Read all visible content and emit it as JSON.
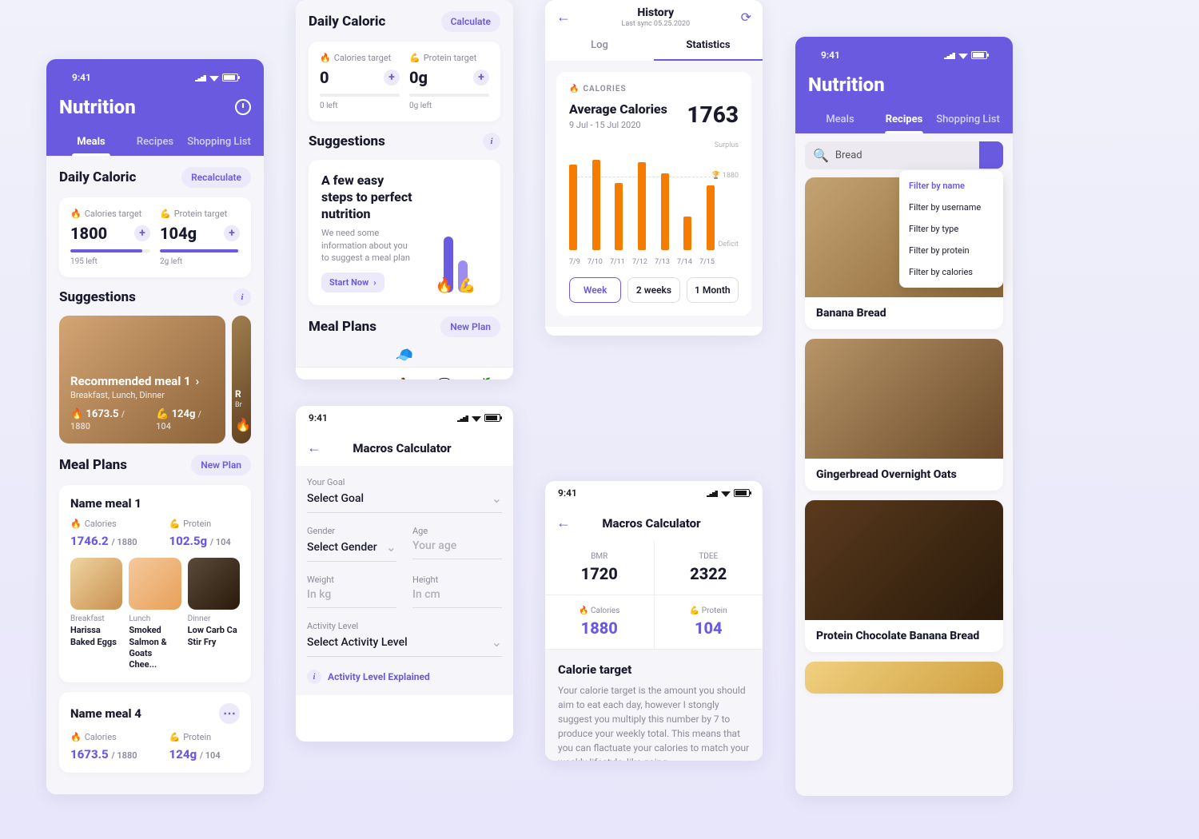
{
  "status_time": "9:41",
  "app_title": "Nutrition",
  "tabs": [
    "Meals",
    "Recipes",
    "Shopping List"
  ],
  "screen1": {
    "daily_title": "Daily Caloric",
    "recalc": "Recalculate",
    "cal_label": "Calories target",
    "cal_val": "1800",
    "cal_left": "195 left",
    "pro_label": "Protein target",
    "pro_val": "104g",
    "pro_left": "2g left",
    "sugg_title": "Suggestions",
    "rec_meal": "Recommended meal 1",
    "rec_sub": "Breakfast, Lunch, Dinner",
    "rec_cal": "1673.5",
    "rec_cal_max": "/ 1880",
    "rec_pro": "124g",
    "rec_pro_max": "/ 104",
    "mp_title": "Meal Plans",
    "new_plan": "New Plan",
    "meal1_name": "Name meal 1",
    "cal_lbl": "Calories",
    "pro_lbl": "Protein",
    "m1_cal": "1746.2",
    "m1_cal_max": "/ 1880",
    "m1_pro": "102.5g",
    "m1_pro_max": "/ 104",
    "items": [
      {
        "time": "Breakfast",
        "name": "Harissa Baked Eggs"
      },
      {
        "time": "Lunch",
        "name": "Smoked Salmon & Goats Chee..."
      },
      {
        "time": "Dinner",
        "name": "Low Carb Ca Stir Fry"
      }
    ],
    "meal4_name": "Name meal 4",
    "m4_cal": "1673.5",
    "m4_pro": "124g"
  },
  "screen2": {
    "daily_title": "Daily Caloric",
    "calc": "Calculate",
    "cal_val": "0",
    "cal_left": "0 left",
    "pro_val": "0g",
    "pro_left": "0g left",
    "sugg_title": "Suggestions",
    "box_title": "A few easy steps to perfect nutrition",
    "box_text": "We need some information about you to suggest a meal plan",
    "start": "Start Now",
    "mp_title": "Meal Plans",
    "new_plan": "New Plan"
  },
  "history": {
    "title": "History",
    "sync": "Last sync 05.25.2020",
    "tabs": [
      "Log",
      "Statistics"
    ],
    "cal_lbl": "CALORIES",
    "avg": "Average Calories",
    "range": "9 Jul - 15 Jul 2020",
    "avg_val": "1763",
    "surplus": "Surplus",
    "goal": "1880",
    "deficit": "Deficit",
    "periods": [
      "Week",
      "2 weeks",
      "1 Month"
    ]
  },
  "chart_data": {
    "type": "bar",
    "categories": [
      "7/9",
      "7/10",
      "7/11",
      "7/12",
      "7/13",
      "7/14",
      "7/15"
    ],
    "values": [
      1950,
      2020,
      1700,
      2000,
      1820,
      1200,
      1650
    ],
    "goal_line": 1880,
    "ylim": [
      0,
      2200
    ],
    "labels": {
      "top": "Surplus",
      "goal": "1880",
      "bottom": "Deficit"
    }
  },
  "calc": {
    "title": "Macros Calculator",
    "goal_lbl": "Your Goal",
    "goal_ph": "Select Goal",
    "gender_lbl": "Gender",
    "gender_ph": "Select Gender",
    "age_lbl": "Age",
    "age_ph": "Your age",
    "weight_lbl": "Weight",
    "weight_ph": "In kg",
    "height_lbl": "Height",
    "height_ph": "In cm",
    "act_lbl": "Activity Level",
    "act_ph": "Select Activity Level",
    "explain": "Activity Level Explained"
  },
  "calc_res": {
    "bmr_lbl": "BMR",
    "bmr": "1720",
    "tdee_lbl": "TDEE",
    "tdee": "2322",
    "cal_lbl": "Calories",
    "cal": "1880",
    "pro_lbl": "Protein",
    "pro": "104",
    "ct_title": "Calorie target",
    "ct_text": "Your calorie target is the amount you should aim to eat each day, however I stongly suggest you multiply this number by 7 to produce your weekly total. This means that you can flactuate your calories to match your weekly lifestyle, like going"
  },
  "recipes": {
    "search": "Bread",
    "filters": [
      "Filter by name",
      "Filter by username",
      "Filter by type",
      "Filter by protein",
      "Filter by calories"
    ],
    "items": [
      "Banana Bread",
      "Gingerbread Overnight Oats",
      "Protein Chocolate Banana Bread"
    ]
  }
}
